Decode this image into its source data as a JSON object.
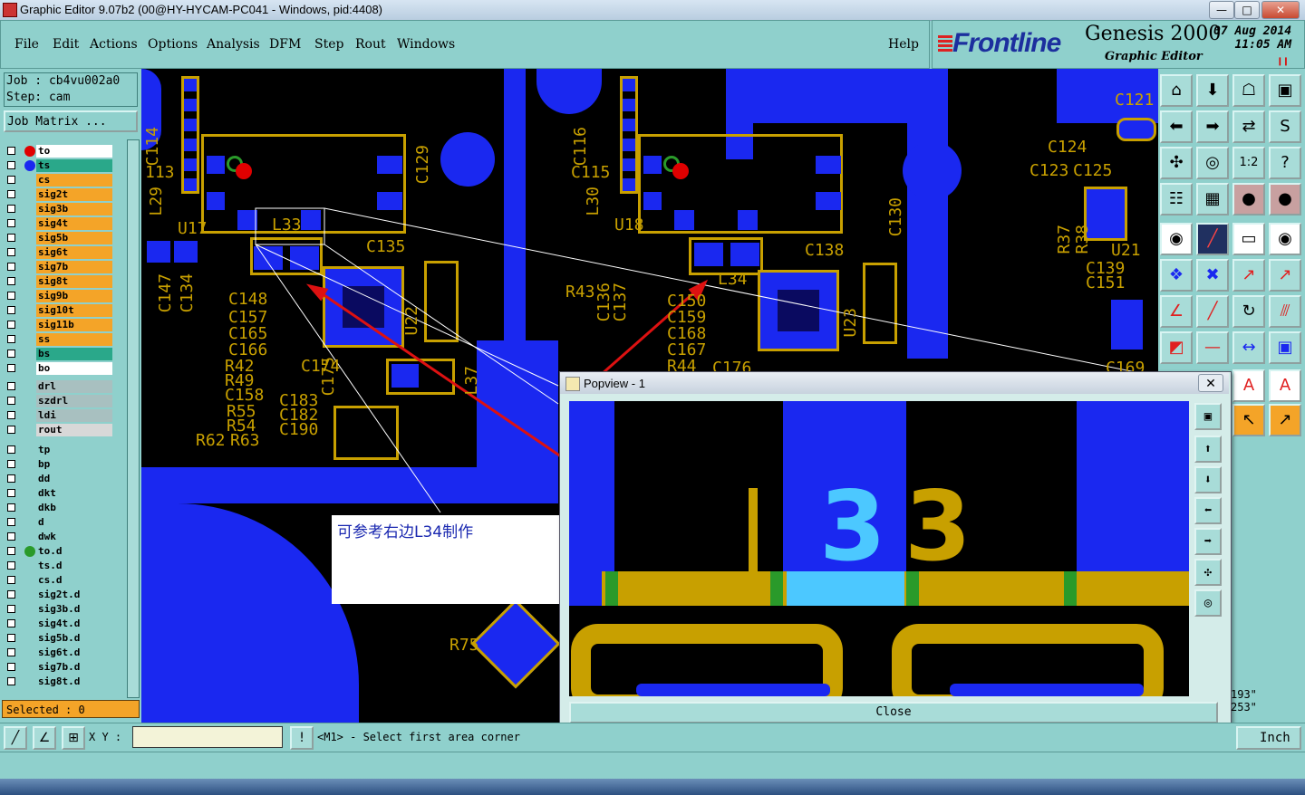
{
  "window": {
    "title": "Graphic Editor 9.07b2 (00@HY-HYCAM-PC041 - Windows, pid:4408)",
    "buttons": [
      "—",
      "□",
      "✕"
    ]
  },
  "menu": [
    "File",
    "Edit",
    "Actions",
    "Options",
    "Analysis",
    "DFM",
    "Step",
    "Rout",
    "Windows",
    "Help"
  ],
  "brand": {
    "company": "Frontline",
    "product": "Genesis 2000",
    "subtitle": "Graphic Editor",
    "date": "07 Aug 2014",
    "time": "11:05 AM"
  },
  "job": {
    "job_line": "Job : cb4vu002a0",
    "step_line": "Step: cam",
    "matrix_button": "Job Matrix ..."
  },
  "layers_board": [
    {
      "name": "to",
      "bg": "#ffffff",
      "dot": "#e00000"
    },
    {
      "name": "ts",
      "bg": "#2aa88a",
      "dot": "#1a28f0"
    },
    {
      "name": "cs",
      "bg": "#f4a428",
      "dot": ""
    },
    {
      "name": "sig2t",
      "bg": "#f4a428",
      "dot": ""
    },
    {
      "name": "sig3b",
      "bg": "#f4a428",
      "dot": ""
    },
    {
      "name": "sig4t",
      "bg": "#f4a428",
      "dot": ""
    },
    {
      "name": "sig5b",
      "bg": "#f4a428",
      "dot": ""
    },
    {
      "name": "sig6t",
      "bg": "#f4a428",
      "dot": ""
    },
    {
      "name": "sig7b",
      "bg": "#f4a428",
      "dot": ""
    },
    {
      "name": "sig8t",
      "bg": "#f4a428",
      "dot": ""
    },
    {
      "name": "sig9b",
      "bg": "#f4a428",
      "dot": ""
    },
    {
      "name": "sig10t",
      "bg": "#f4a428",
      "dot": ""
    },
    {
      "name": "sig11b",
      "bg": "#f4a428",
      "dot": ""
    },
    {
      "name": "ss",
      "bg": "#f4a428",
      "dot": ""
    },
    {
      "name": "bs",
      "bg": "#2aa88a",
      "dot": ""
    },
    {
      "name": "bo",
      "bg": "#ffffff",
      "dot": ""
    }
  ],
  "layers_drill": [
    {
      "name": "drl",
      "bg": "#a8c0c0"
    },
    {
      "name": "szdrl",
      "bg": "#a8c0c0"
    },
    {
      "name": "ldi",
      "bg": "#a8c0c0"
    },
    {
      "name": "rout",
      "bg": "#d8d8d8"
    }
  ],
  "layers_misc": [
    {
      "name": "tp",
      "bg": "#8fd0cc",
      "dot": ""
    },
    {
      "name": "bp",
      "bg": "#8fd0cc",
      "dot": ""
    },
    {
      "name": "dd",
      "bg": "#8fd0cc",
      "dot": ""
    },
    {
      "name": "dkt",
      "bg": "#8fd0cc",
      "dot": ""
    },
    {
      "name": "dkb",
      "bg": "#8fd0cc",
      "dot": ""
    },
    {
      "name": "d",
      "bg": "#8fd0cc",
      "dot": ""
    },
    {
      "name": "dwk",
      "bg": "#8fd0cc",
      "dot": ""
    },
    {
      "name": "to.d",
      "bg": "#8fd0cc",
      "dot": "#2a9a2a"
    },
    {
      "name": "ts.d",
      "bg": "#8fd0cc",
      "dot": ""
    },
    {
      "name": "cs.d",
      "bg": "#8fd0cc",
      "dot": ""
    },
    {
      "name": "sig2t.d",
      "bg": "#8fd0cc",
      "dot": ""
    },
    {
      "name": "sig3b.d",
      "bg": "#8fd0cc",
      "dot": ""
    },
    {
      "name": "sig4t.d",
      "bg": "#8fd0cc",
      "dot": ""
    },
    {
      "name": "sig5b.d",
      "bg": "#8fd0cc",
      "dot": ""
    },
    {
      "name": "sig6t.d",
      "bg": "#8fd0cc",
      "dot": ""
    },
    {
      "name": "sig7b.d",
      "bg": "#8fd0cc",
      "dot": ""
    },
    {
      "name": "sig8t.d",
      "bg": "#8fd0cc",
      "dot": ""
    }
  ],
  "selected": "Selected : 0",
  "pcb_labels": [
    "C114",
    "113",
    "L29",
    "U17",
    "C129",
    "L33",
    "C135",
    "C148",
    "C157",
    "C165",
    "C166",
    "R42",
    "R49",
    "C158",
    "R55",
    "R54",
    "R62",
    "R63",
    "C174",
    "C175",
    "C183",
    "C182",
    "C190",
    "U22",
    "L37",
    "C116",
    "C115",
    "L30",
    "U18",
    "C138",
    "L34",
    "R43",
    "C136",
    "C137",
    "C150",
    "C159",
    "C168",
    "C167",
    "R44",
    "C176",
    "U23",
    "C130",
    "C121",
    "C124",
    "C123",
    "C125",
    "R37",
    "R38",
    "U21",
    "C139",
    "C151",
    "C169",
    "C134",
    "C147",
    "R75"
  ],
  "note": "可参考右边L34制作",
  "popview": {
    "title": "Popview - 1",
    "zoom_label": "L33",
    "close_button": "Close"
  },
  "xy_label": "X Y :",
  "status": "<M1> - Select first area corner",
  "coords": [
    "193\"",
    "253\""
  ],
  "units": "Inch",
  "colors": {
    "panel": "#8fd0cc",
    "copper": "#1a28f0",
    "silk": "#c8a000",
    "accent": "#f4a428"
  }
}
